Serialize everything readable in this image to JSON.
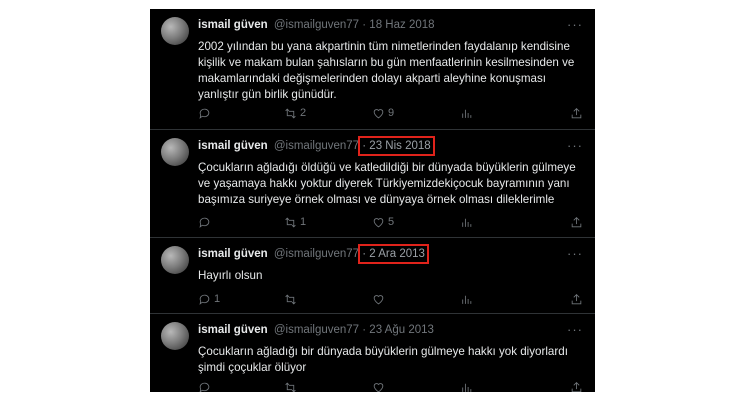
{
  "tweets": [
    {
      "name": "ismail güven",
      "handle": "@ismailguven77",
      "date": "· 18 Haz 2018",
      "date_highlighted": false,
      "text": "2002 yılından bu yana akpartinin tüm nimetlerinden faydalanıp kendisine\nkişilik ve makam bulan şahısların bu gün menfaatlerinin kesilmesinden ve\nmakamlarındaki değişmelerinden dolayı akparti aleyhine konuşması\nyanlıştır gün birlik günüdür.",
      "replies": "",
      "retweets": "2",
      "likes": "9"
    },
    {
      "name": "ismail güven",
      "handle": "@ismailguven77",
      "date": "· 23 Nis 2018",
      "date_highlighted": true,
      "text": "Çocukların ağladığı öldüğü ve katledildiği bir dünyada büyüklerin gülmeye\nve yaşamaya hakkı yoktur diyerek Türkiyemizdekiçocuk bayramının yanı\nbaşımıza suriyeye örnek olması ve dünyaya örnek olması dileklerimle",
      "replies": "",
      "retweets": "1",
      "likes": "5"
    },
    {
      "name": "ismail güven",
      "handle": "@ismailguven77",
      "date": "· 2 Ara 2013",
      "date_highlighted": true,
      "text": "Hayırlı olsun",
      "replies": "1",
      "retweets": "",
      "likes": ""
    },
    {
      "name": "ismail güven",
      "handle": "@ismailguven77",
      "date": "· 23 Ağu 2013",
      "date_highlighted": false,
      "text": "Çocukların ağladığı bir dünyada büyüklerin gülmeye hakkı yok diyorlardı\nşimdi çoçuklar ölüyor",
      "replies": "",
      "retweets": "",
      "likes": ""
    }
  ]
}
